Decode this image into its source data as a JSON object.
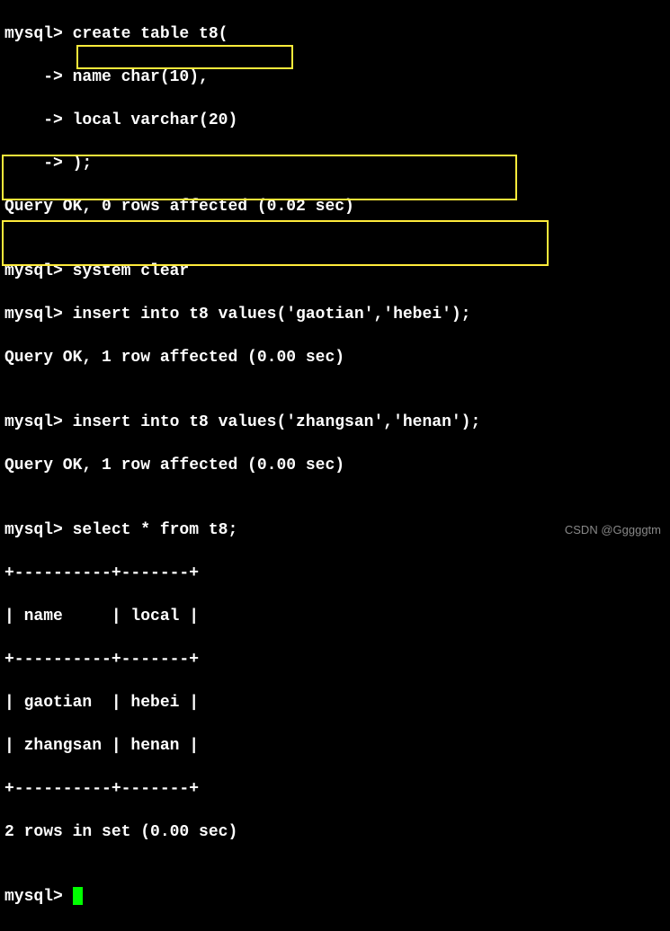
{
  "lines": {
    "l1": "mysql> create table t8(",
    "l2": "    -> name char(10),",
    "l3": "    -> local varchar(20)",
    "l3_prefix": "    -> ",
    "l3_hl": "local varchar(20)",
    "l4": "    -> );",
    "l5": "Query OK, 0 rows affected (0.02 sec)",
    "l6": "",
    "l7": "mysql> system clear",
    "l8": "mysql> insert into t8 values('gaotian','hebei');",
    "l9": "Query OK, 1 row affected (0.00 sec)",
    "l10": "",
    "l11": "mysql> insert into t8 values('zhangsan','henan');",
    "l12": "Query OK, 1 row affected (0.00 sec)",
    "l13": "",
    "l14": "mysql> select * from t8;",
    "l15": "+----------+-------+",
    "l16": "| name     | local |",
    "l17": "+----------+-------+",
    "l18": "| gaotian  | hebei |",
    "l19": "| zhangsan | henan |",
    "l20": "+----------+-------+",
    "l21": "2 rows in set (0.00 sec)",
    "l22": "",
    "l23": "mysql> "
  },
  "watermark": "CSDN @Gggggtm"
}
